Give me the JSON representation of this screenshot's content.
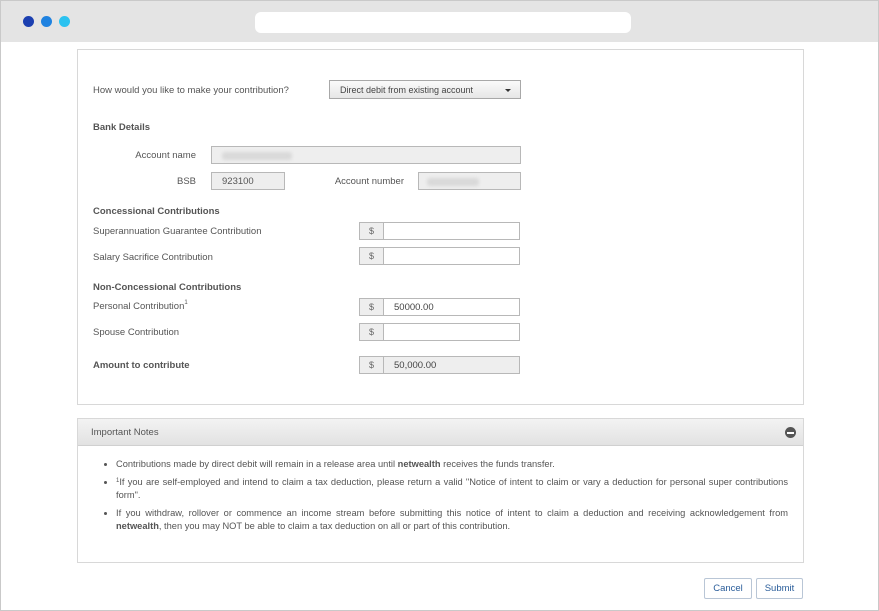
{
  "form": {
    "question": "How would you like to make your contribution?",
    "method_selected": "Direct debit from existing account",
    "bank_details": {
      "heading": "Bank Details",
      "account_name_label": "Account name",
      "account_name_value": "",
      "bsb_label": "BSB",
      "bsb_value": "923100",
      "account_number_label": "Account number",
      "account_number_value": ""
    },
    "concessional": {
      "heading": "Concessional Contributions",
      "sg_label": "Superannuation Guarantee Contribution",
      "sg_value": "",
      "salary_label": "Salary Sacrifice Contribution",
      "salary_value": ""
    },
    "non_concessional": {
      "heading": "Non-Concessional Contributions",
      "personal_label": "Personal Contribution",
      "personal_sup": "1",
      "personal_value": "50000.00",
      "spouse_label": "Spouse Contribution",
      "spouse_value": ""
    },
    "total_label": "Amount to contribute",
    "total_value": "50,000.00",
    "currency_symbol": "$"
  },
  "notes": {
    "title": "Important Notes",
    "items": [
      {
        "pre": "Contributions made by direct debit will remain in a release area until ",
        "bold": "netwealth",
        "post": " receives the funds transfer."
      },
      {
        "sup": "1",
        "text": "If you are self-employed and intend to claim a tax deduction, please return a valid \"Notice of intent to claim or vary a deduction for personal super contributions form\"."
      },
      {
        "pre": "If you withdraw, rollover or commence an income stream before submitting this notice of intent to claim a deduction and receiving acknowledgement from ",
        "bold": "netwealth",
        "post": ", then you may NOT be able to claim a tax deduction on all or part of this contribution."
      }
    ]
  },
  "actions": {
    "cancel_label": "Cancel",
    "submit_label": "Submit"
  },
  "colors": {
    "dot_1": "#1b3fb0",
    "dot_2": "#1f82e0",
    "dot_3": "#2bc2f0",
    "button_text": "#2a5d9a"
  }
}
